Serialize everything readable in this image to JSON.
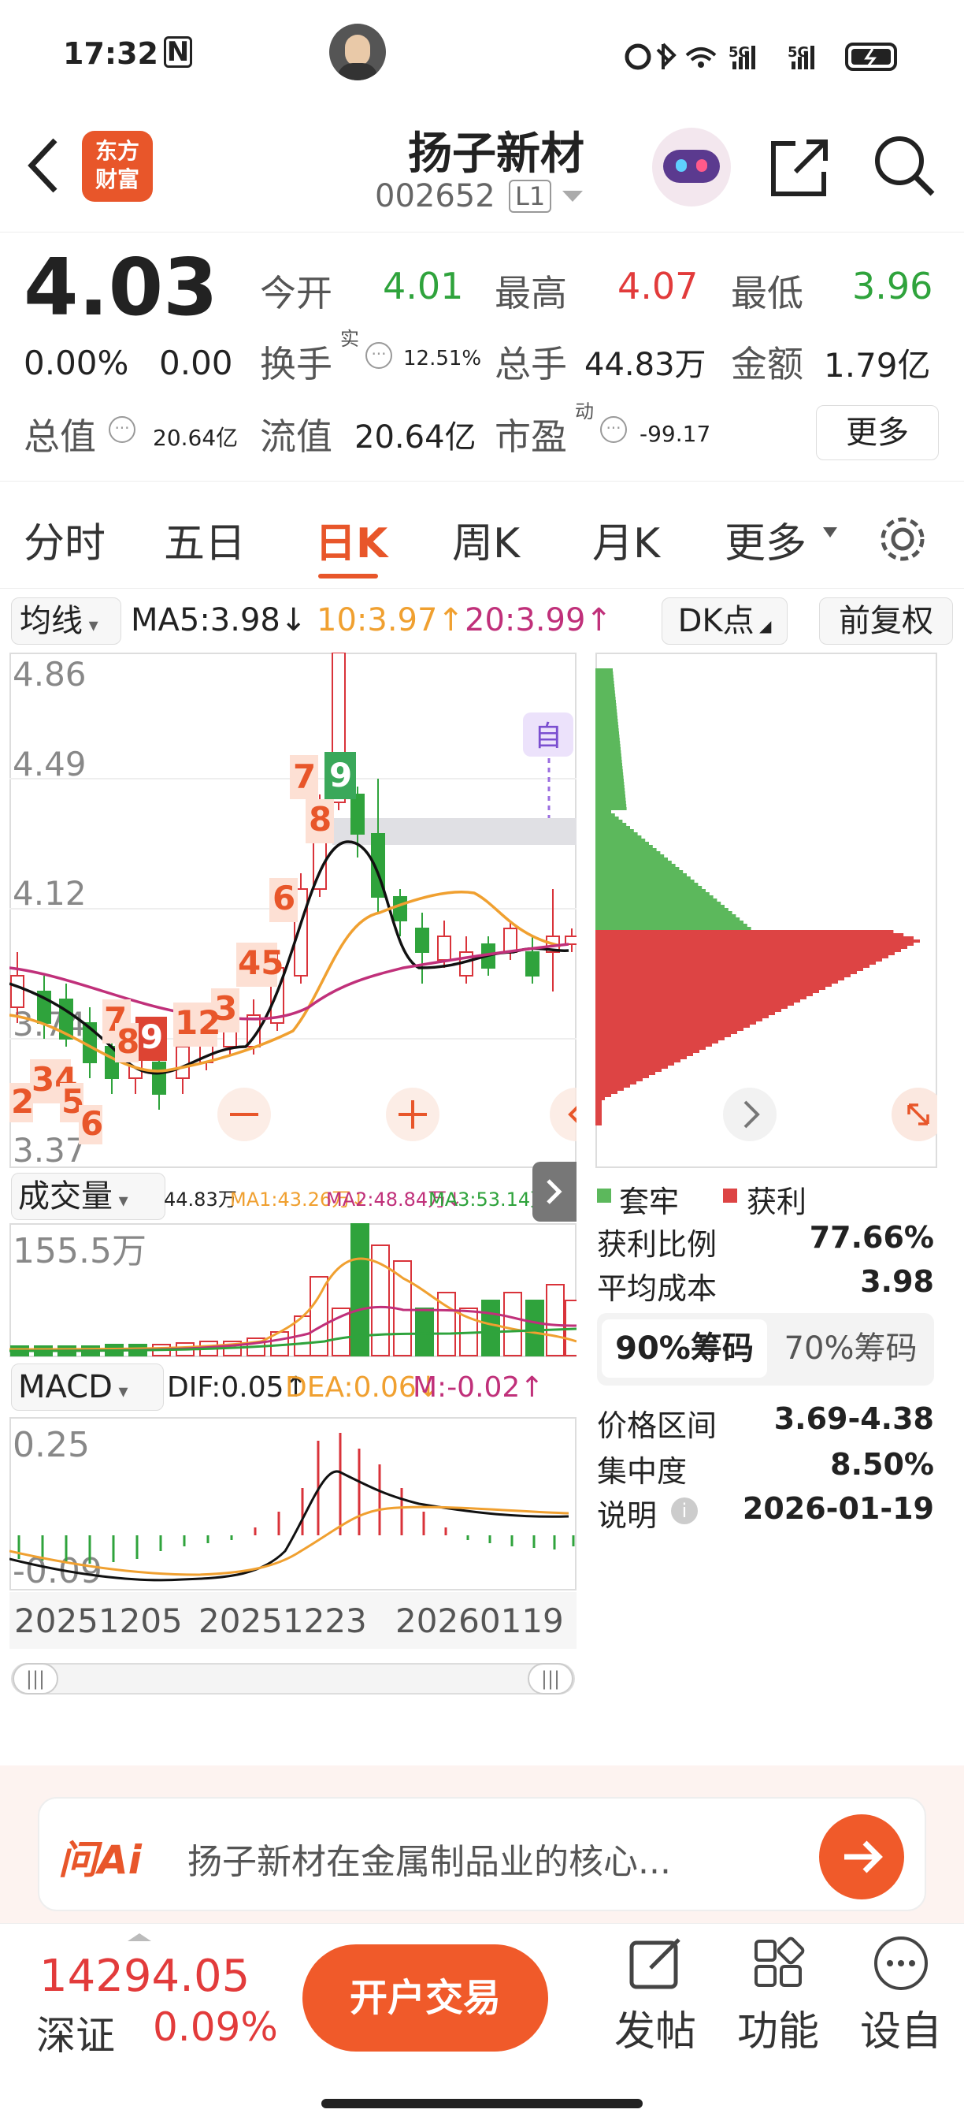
{
  "status": {
    "time": "17:32",
    "nfc": "N",
    "network": "5G"
  },
  "header": {
    "logo_line1": "东方",
    "logo_line2": "财富",
    "stock_name": "扬子新材",
    "code": "002652",
    "level": "L1"
  },
  "quote": {
    "price": "4.03",
    "change_pct": "0.00%",
    "change": "0.00",
    "open_label": "今开",
    "open": "4.01",
    "high_label": "最高",
    "high": "4.07",
    "low_label": "最低",
    "low": "3.96",
    "turnover_label": "换手",
    "turnover_sup": "实",
    "turnover": "12.51%",
    "volume_label": "总手",
    "volume": "44.83万",
    "amount_label": "金额",
    "amount": "1.79亿",
    "mcap_label": "总值",
    "mcap": "20.64亿",
    "float_label": "流值",
    "float": "20.64亿",
    "pe_label": "市盈",
    "pe_sup": "动",
    "pe": "-99.17",
    "more": "更多"
  },
  "tabs": [
    "分时",
    "五日",
    "日K",
    "周K",
    "月K",
    "更多"
  ],
  "ma_bar": {
    "selector": "均线",
    "ma5": "MA5:3.98",
    "ma10": "10:3.97",
    "ma20": "20:3.99",
    "dk": "DK点",
    "adj": "前复权"
  },
  "kline": {
    "y_labels": [
      "4.86",
      "4.49",
      "4.12",
      "3.74",
      "3.37"
    ],
    "tag_auto": "自"
  },
  "volume_bar": {
    "selector": "成交量",
    "value": "44.83万",
    "ma1": "MA1:43.26万",
    "ma2": "MA2:48.84万",
    "ma3": "MA3:53.14万",
    "ymax": "155.5万"
  },
  "macd_bar": {
    "selector": "MACD",
    "dif": "DIF:0.05",
    "dea": "DEA:0.06",
    "m": "M:-0.02",
    "ymax": "0.25",
    "ymin": "-0.09"
  },
  "dates": {
    "d1": "20251205",
    "d2": "20251223",
    "d3": "20260119"
  },
  "chip": {
    "legend_trap": "套牢",
    "legend_profit": "获利",
    "profit_ratio_label": "获利比例",
    "profit_ratio": "77.66%",
    "avg_cost_label": "平均成本",
    "avg_cost": "3.98",
    "tab90": "90%筹码",
    "tab70": "70%筹码",
    "range_label": "价格区间",
    "range": "3.69-4.38",
    "conc_label": "集中度",
    "conc": "8.50%",
    "note_label": "说明",
    "note": "2026-01-19"
  },
  "ai": {
    "logo": "问Ai",
    "text": "扬子新材在金属制品业的核心..."
  },
  "bottom": {
    "index_value": "14294.05",
    "index_name": "深证",
    "index_pct": "0.09%",
    "trade": "开户交易",
    "post": "发帖",
    "func": "功能",
    "settings": "设自"
  },
  "colors": {
    "accent": "#e8562a",
    "up": "#e23b3b",
    "down": "#2fa33c",
    "ma10": "#f0a030",
    "ma20": "#c0307a"
  }
}
